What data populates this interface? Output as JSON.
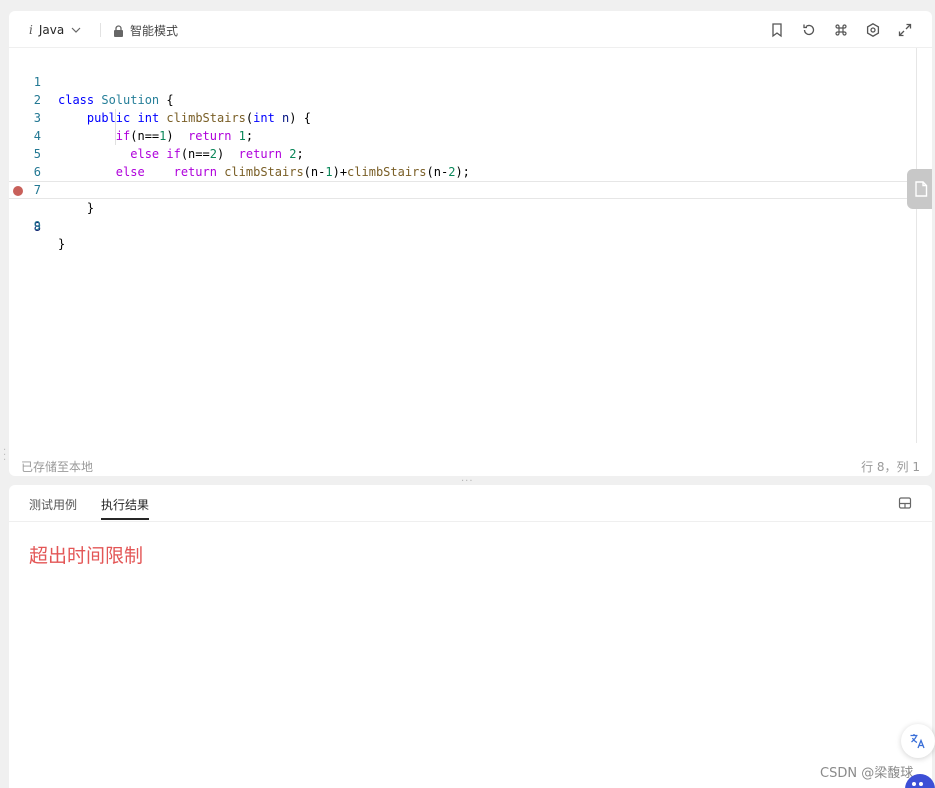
{
  "toolbar": {
    "language": "Java",
    "language_icon": "i",
    "mode_label": "智能模式",
    "icons": [
      "bookmark-icon",
      "reset-icon",
      "command-icon",
      "settings-icon",
      "fullscreen-icon"
    ]
  },
  "editor": {
    "lines": [
      {
        "num": "1"
      },
      {
        "num": "2"
      },
      {
        "num": "3"
      },
      {
        "num": "4"
      },
      {
        "num": "5"
      },
      {
        "num": "6"
      },
      {
        "num": "7"
      },
      {
        "num": "8"
      },
      {
        "num": "9"
      }
    ],
    "code": {
      "l1_kw": "class",
      "l1_name": "Solution",
      "l1_rest": " {",
      "l2_kw": "public",
      "l2_type": "int",
      "l2_fn": "climbStairs",
      "l2_p": "(",
      "l2_type2": "int",
      "l2_var": " n",
      "l2_rest": ") {",
      "l3_kw": "if",
      "l3_a": "(n==",
      "l3_num": "1",
      "l3_b": ")  ",
      "l3_kw2": "return",
      "l3_num2": " 1",
      "l3_c": ";",
      "l4_kw": "else if",
      "l4_a": "(n==",
      "l4_num": "2",
      "l4_b": ")  ",
      "l4_kw2": "return",
      "l4_num2": " 2",
      "l4_c": ";",
      "l5_kw": "else",
      "l5_sp": "    ",
      "l5_kw2": "return",
      "l5_fn": " climbStairs",
      "l5_a": "(n-",
      "l5_num": "1",
      "l5_b": ")+",
      "l5_fn2": "climbStairs",
      "l5_c": "(n-",
      "l5_num2": "2",
      "l5_d": ");",
      "l7": "}",
      "l9": "}"
    },
    "breakpoint_line": "8"
  },
  "status": {
    "saved": "已存储至本地",
    "position": "行 8，列 1"
  },
  "result": {
    "tabs": [
      {
        "label": "测试用例"
      },
      {
        "label": "执行结果"
      }
    ],
    "selected_tab": "执行结果",
    "message": "超出时间限制",
    "message_color": "#e35656"
  },
  "watermark": "CSDN @梁馥球"
}
